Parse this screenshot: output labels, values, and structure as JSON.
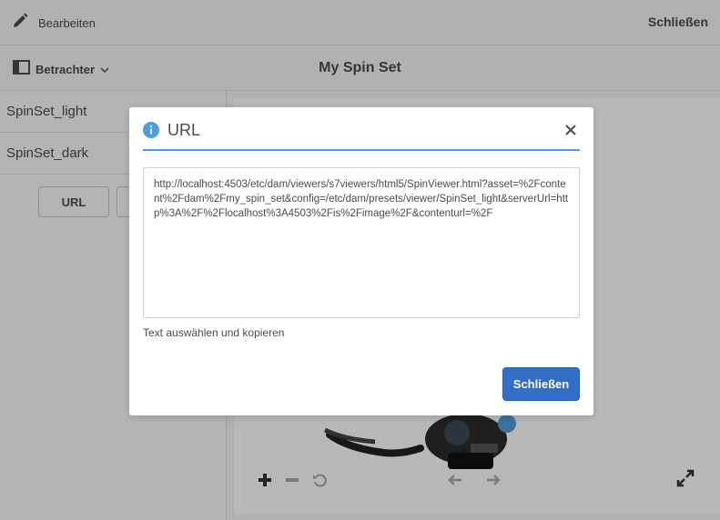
{
  "topbar": {
    "edit_label": "Bearbeiten",
    "close_label": "Schließen"
  },
  "subbar": {
    "viewer_label": "Betrachter",
    "title": "My Spin Set"
  },
  "rail": {
    "items": [
      {
        "label": "SpinSet_light"
      },
      {
        "label": "SpinSet_dark"
      }
    ],
    "url_button": "URL"
  },
  "viewer": {
    "icons": [
      "zoom-in-icon",
      "zoom-out-icon",
      "reset-icon",
      "arrow-left-icon",
      "arrow-right-icon",
      "fullscreen-icon"
    ]
  },
  "dialog": {
    "title": "URL",
    "url_value": "http://localhost:4503/etc/dam/viewers/s7viewers/html5/SpinViewer.html?asset=%2Fcontent%2Fdam%2Fmy_spin_set&config=/etc/dam/presets/viewer/SpinSet_light&serverUrl=http%3A%2F%2Flocalhost%3A4503%2Fis%2Fimage%2F&contenturl=%2F",
    "hint": "Text auswählen und kopieren",
    "close_button": "Schließen"
  },
  "colors": {
    "accent": "#326ec8",
    "header_rule": "#4b9ce6",
    "info_icon": "#4b9ce6"
  }
}
